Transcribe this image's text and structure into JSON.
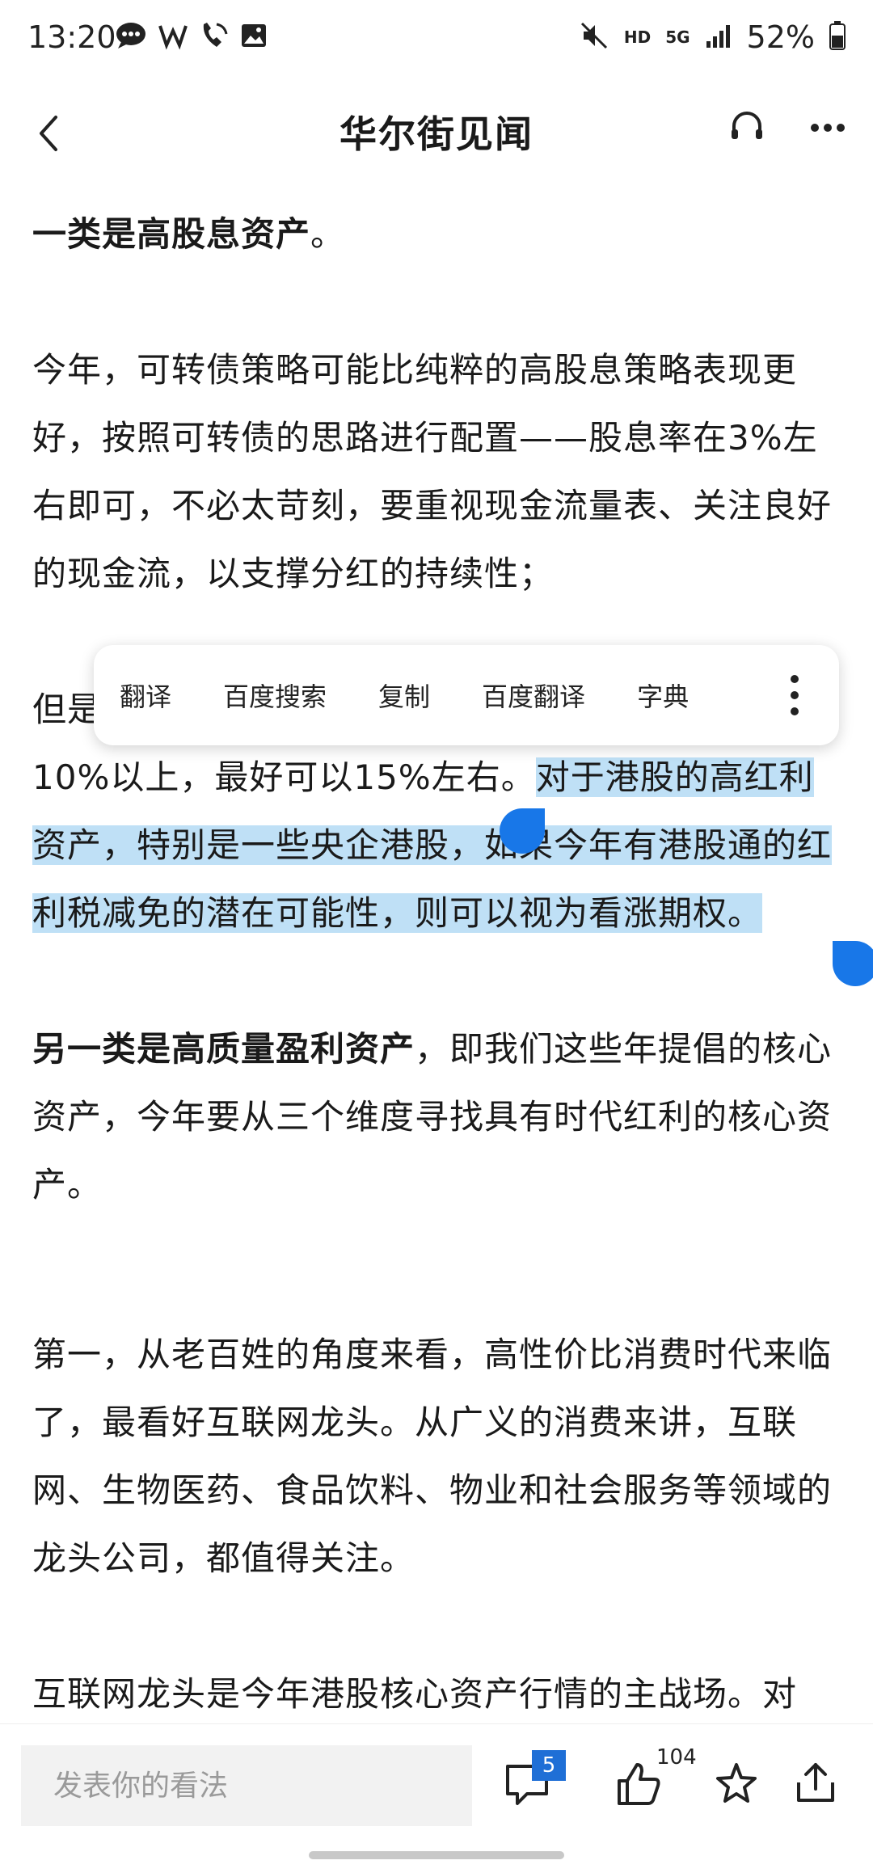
{
  "status_bar": {
    "time": "13:20",
    "network": "HD",
    "network_gen": "5G",
    "battery": "52%"
  },
  "header": {
    "title": "华尔街见闻"
  },
  "article": {
    "p1_bold": "一类是高股息资产",
    "p1_tail": "。",
    "p2": "今年，可转债策略可能比纯粹的高股息策略表现更好，按照可转债的思路进行配置——股息率在3%左右即可，不必太苛刻，要重视现金流量表、关注良好的现金流，以支撑分红的持续性；",
    "p3_head": "但是",
    "p3_line2": "10%以上，最好可以15%左右。",
    "p3_selected": "对于港股的高红利资产，特别是一些央企港股，如果今年有港股通的红利税减免的潜在可能性，则可以视为看涨期权。",
    "p4_bold": "另一类是高质量盈利资产",
    "p4_tail": "，即我们这些年提倡的核心资产，今年要从三个维度寻找具有时代红利的核心资产。",
    "p5": "第一，从老百姓的角度来看，高性价比消费时代来临了，最看好互联网龙头。从广义的消费来讲，互联网、生物医药、食品饮料、物业和社会服务等领域的龙头公司，都值得关注。",
    "p6": "互联网龙头是今年港股核心资产行情的主战场。对"
  },
  "selection_menu": {
    "items": [
      "翻译",
      "百度搜索",
      "复制",
      "百度翻译",
      "字典"
    ]
  },
  "bottom_bar": {
    "comment_placeholder": "发表你的看法",
    "comment_count": "5",
    "like_count": "104"
  },
  "icons": {
    "back": "back-arrow-icon",
    "listen": "headphones-icon",
    "more": "more-dots-icon",
    "comment": "comment-bubble-icon",
    "like": "thumbs-up-icon",
    "favorite": "star-icon",
    "share": "share-icon"
  },
  "colors": {
    "selection_highlight": "#bfe0f6",
    "selection_handle": "#1877e8",
    "badge": "#1f6fd6"
  }
}
